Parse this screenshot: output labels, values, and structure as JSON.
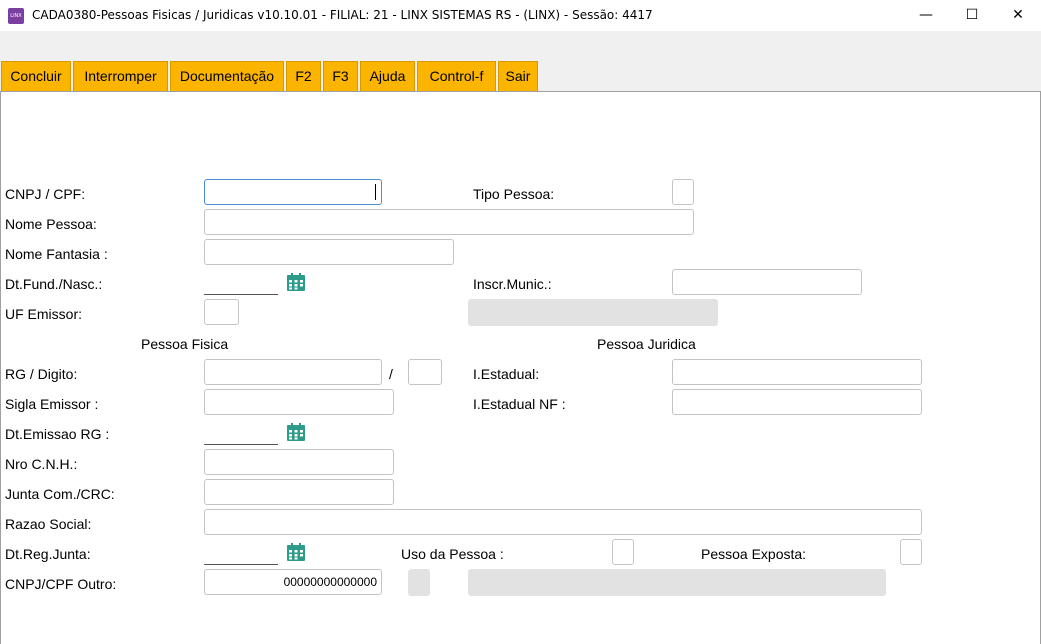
{
  "window": {
    "title": "CADA0380-Pessoas Fisicas / Juridicas v10.10.01   - FILIAL: 21 - LINX SISTEMAS RS - (LINX) - Sessão: 4417",
    "app_icon_text": "LINX",
    "minimize_symbol": "—",
    "maximize_symbol": "☐",
    "close_symbol": "✕"
  },
  "toolbar": {
    "tabs": [
      "Concluir",
      "Interromper",
      "Documentação",
      "F2",
      "F3",
      "Ajuda",
      "Control-f",
      "Sair"
    ]
  },
  "form": {
    "cnpj_cpf_label": "CNPJ / CPF:",
    "tipo_pessoa_label": "Tipo Pessoa:",
    "nome_pessoa_label": "Nome Pessoa:",
    "nome_fantasia_label": "Nome Fantasia :",
    "dt_fund_label": "Dt.Fund./Nasc.:",
    "inscr_munic_label": "Inscr.Munic.:",
    "uf_emissor_label": "UF Emissor:",
    "section_pessoa_fisica": "Pessoa Fisica",
    "section_pessoa_juridica": "Pessoa Juridica",
    "rg_digito_label": "RG / Digito:",
    "rg_separator": "/",
    "i_estadual_label": "I.Estadual:",
    "sigla_emissor_label": "Sigla Emissor :",
    "i_estadual_nf_label": "I.Estadual NF :",
    "dt_emissao_rg_label": "Dt.Emissao RG :",
    "nro_cnh_label": "Nro C.N.H.:",
    "junta_com_label": "Junta Com./CRC:",
    "razao_social_label": "Razao Social:",
    "dt_reg_junta_label": "Dt.Reg.Junta:",
    "uso_da_pessoa_label": "Uso da Pessoa :",
    "pessoa_exposta_label": "Pessoa Exposta:",
    "cnpj_cpf_outro_label": "CNPJ/CPF Outro:",
    "cnpj_cpf_outro_value": "00000000000000"
  },
  "colors": {
    "tab_background": "#fbb500",
    "calendar_icon": "#2e9a8a",
    "readonly_field": "#e2e2e2"
  }
}
